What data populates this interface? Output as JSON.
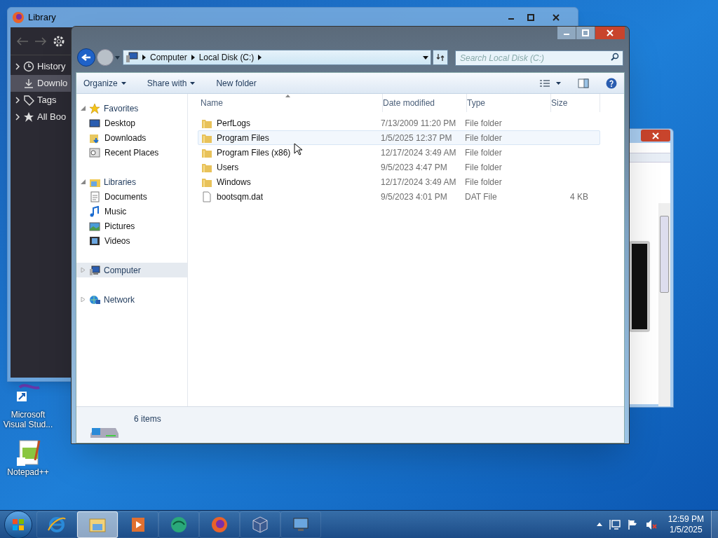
{
  "desktop_icons": [
    {
      "label": "Microsoft Visual Stud...",
      "kind": "vs"
    },
    {
      "label": "Notepad++",
      "kind": "notepad"
    }
  ],
  "library_window": {
    "title": "Library",
    "nav": [
      {
        "label": "History",
        "kind": "history",
        "expandable": true,
        "selected": false
      },
      {
        "label": "Downlo",
        "kind": "download",
        "expandable": false,
        "selected": true
      },
      {
        "label": "Tags",
        "kind": "tag",
        "expandable": true,
        "selected": false
      },
      {
        "label": "All Boo",
        "kind": "star",
        "expandable": true,
        "selected": false
      }
    ]
  },
  "explorer": {
    "breadcrumbs": [
      "Computer",
      "Local Disk (C:)"
    ],
    "search": {
      "placeholder": "Search Local Disk (C:)"
    },
    "toolbar": [
      {
        "label": "Organize",
        "dropdown": true
      },
      {
        "label": "Share with",
        "dropdown": true
      },
      {
        "label": "New folder",
        "dropdown": false
      }
    ],
    "nav": [
      {
        "label": "Favorites",
        "kind": "star",
        "selected": false,
        "children": [
          {
            "label": "Desktop",
            "kind": "desktop",
            "selected": false
          },
          {
            "label": "Downloads",
            "kind": "downloads",
            "selected": false
          },
          {
            "label": "Recent Places",
            "kind": "recent",
            "selected": false
          }
        ]
      },
      {
        "label": "Libraries",
        "kind": "libraries",
        "selected": false,
        "children": [
          {
            "label": "Documents",
            "kind": "documents",
            "selected": false
          },
          {
            "label": "Music",
            "kind": "music",
            "selected": false
          },
          {
            "label": "Pictures",
            "kind": "pictures",
            "selected": false
          },
          {
            "label": "Videos",
            "kind": "videos",
            "selected": false
          }
        ]
      },
      {
        "label": "Computer",
        "kind": "computer",
        "selected": true
      },
      {
        "label": "Network",
        "kind": "network",
        "selected": false
      }
    ],
    "columns": [
      "Name",
      "Date modified",
      "Type",
      "Size"
    ],
    "rows": [
      {
        "name": "PerfLogs",
        "date": "7/13/2009 11:20 PM",
        "type": "File folder",
        "kind": "folder",
        "hovered": false
      },
      {
        "name": "Program Files",
        "date": "1/5/2025 12:37 PM",
        "type": "File folder",
        "kind": "folder",
        "hovered": true
      },
      {
        "name": "Program Files (x86)",
        "date": "12/17/2024 3:49 AM",
        "type": "File folder",
        "kind": "folder",
        "hovered": false
      },
      {
        "name": "Users",
        "date": "9/5/2023 4:47 PM",
        "type": "File folder",
        "kind": "folder",
        "hovered": false
      },
      {
        "name": "Windows",
        "date": "12/17/2024 3:49 AM",
        "type": "File folder",
        "kind": "folder",
        "hovered": false
      },
      {
        "name": "bootsqm.dat",
        "date": "9/5/2023 4:01 PM",
        "type": "DAT File",
        "size": "4 KB",
        "kind": "file",
        "hovered": false
      }
    ],
    "status_bar": {
      "text": "6 items"
    }
  },
  "taskbar": {
    "apps": [
      {
        "kind": "ie",
        "active": false
      },
      {
        "kind": "explorer",
        "active": true
      },
      {
        "kind": "media",
        "active": false
      },
      {
        "kind": "green",
        "active": false
      },
      {
        "kind": "firefox",
        "active": false
      },
      {
        "kind": "box",
        "active": false
      },
      {
        "kind": "monitor",
        "active": false
      }
    ],
    "time": "12:59 PM",
    "date": "1/5/2025"
  }
}
